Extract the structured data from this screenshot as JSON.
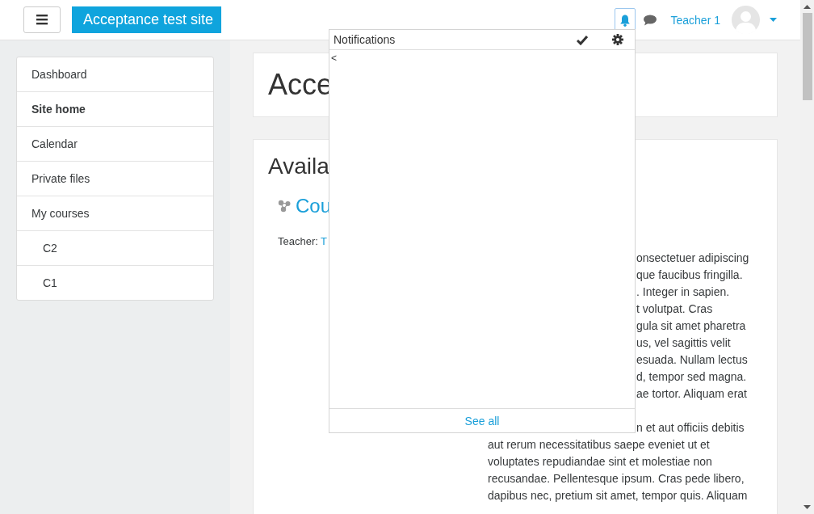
{
  "header": {
    "site_name": "Acceptance test site",
    "notifications_selected": true,
    "user_name": "Teacher 1"
  },
  "sidebar": {
    "items": [
      {
        "label": "Dashboard",
        "selected": false
      },
      {
        "label": "Site home",
        "selected": true
      },
      {
        "label": "Calendar",
        "selected": false
      },
      {
        "label": "Private files",
        "selected": false
      },
      {
        "label": "My courses",
        "selected": false,
        "children": [
          {
            "label": "C2",
            "selected": false
          },
          {
            "label": "C1",
            "selected": false
          }
        ]
      }
    ]
  },
  "main": {
    "page_heading": "Acce",
    "section_heading": "Availa",
    "course": {
      "title": "Cou",
      "teacher_label": "Teacher:",
      "teacher_name": "T",
      "summary": [
        {
          "lines": [
            {
              "text": "onsectetuer adipiscing",
              "covered": true
            },
            {
              "text": "que faucibus fringilla.",
              "covered": true
            },
            {
              "text": ". Integer in sapien.",
              "covered": true
            },
            {
              "text": "t volutpat. Cras",
              "covered": true
            },
            {
              "text": "gula sit amet pharetra",
              "covered": true
            },
            {
              "text": "us, vel sagittis velit",
              "covered": true
            },
            {
              "text": "esuada. Nullam lectus",
              "covered": true
            },
            {
              "text": "d, tempor sed magna.",
              "covered": true
            },
            {
              "text": "ae tortor. Aliquam erat",
              "covered": true
            }
          ]
        },
        {
          "lines": [
            {
              "text": "n et aut officiis debitis",
              "covered": true
            },
            {
              "text": "aut rerum necessitatibus saepe eveniet ut et",
              "covered": false
            },
            {
              "text": "voluptates repudiandae sint et molestiae non",
              "covered": false
            },
            {
              "text": "recusandae. Pellentesque ipsum. Cras pede libero,",
              "covered": false
            },
            {
              "text": "dapibus nec, pretium sit amet, tempor quis. Aliquam",
              "covered": false
            }
          ]
        }
      ]
    }
  },
  "notifications_popup": {
    "title": "Notifications",
    "body_text": "<",
    "footer_link": "See all"
  }
}
